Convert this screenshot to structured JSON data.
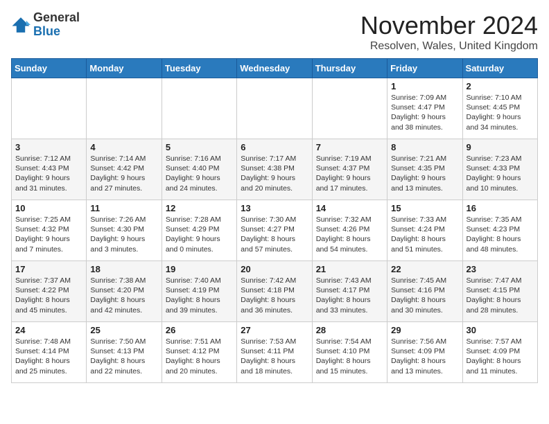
{
  "logo": {
    "general": "General",
    "blue": "Blue"
  },
  "title": "November 2024",
  "location": "Resolven, Wales, United Kingdom",
  "days_of_week": [
    "Sunday",
    "Monday",
    "Tuesday",
    "Wednesday",
    "Thursday",
    "Friday",
    "Saturday"
  ],
  "weeks": [
    [
      {
        "day": "",
        "info": ""
      },
      {
        "day": "",
        "info": ""
      },
      {
        "day": "",
        "info": ""
      },
      {
        "day": "",
        "info": ""
      },
      {
        "day": "",
        "info": ""
      },
      {
        "day": "1",
        "info": "Sunrise: 7:09 AM\nSunset: 4:47 PM\nDaylight: 9 hours and 38 minutes."
      },
      {
        "day": "2",
        "info": "Sunrise: 7:10 AM\nSunset: 4:45 PM\nDaylight: 9 hours and 34 minutes."
      }
    ],
    [
      {
        "day": "3",
        "info": "Sunrise: 7:12 AM\nSunset: 4:43 PM\nDaylight: 9 hours and 31 minutes."
      },
      {
        "day": "4",
        "info": "Sunrise: 7:14 AM\nSunset: 4:42 PM\nDaylight: 9 hours and 27 minutes."
      },
      {
        "day": "5",
        "info": "Sunrise: 7:16 AM\nSunset: 4:40 PM\nDaylight: 9 hours and 24 minutes."
      },
      {
        "day": "6",
        "info": "Sunrise: 7:17 AM\nSunset: 4:38 PM\nDaylight: 9 hours and 20 minutes."
      },
      {
        "day": "7",
        "info": "Sunrise: 7:19 AM\nSunset: 4:37 PM\nDaylight: 9 hours and 17 minutes."
      },
      {
        "day": "8",
        "info": "Sunrise: 7:21 AM\nSunset: 4:35 PM\nDaylight: 9 hours and 13 minutes."
      },
      {
        "day": "9",
        "info": "Sunrise: 7:23 AM\nSunset: 4:33 PM\nDaylight: 9 hours and 10 minutes."
      }
    ],
    [
      {
        "day": "10",
        "info": "Sunrise: 7:25 AM\nSunset: 4:32 PM\nDaylight: 9 hours and 7 minutes."
      },
      {
        "day": "11",
        "info": "Sunrise: 7:26 AM\nSunset: 4:30 PM\nDaylight: 9 hours and 3 minutes."
      },
      {
        "day": "12",
        "info": "Sunrise: 7:28 AM\nSunset: 4:29 PM\nDaylight: 9 hours and 0 minutes."
      },
      {
        "day": "13",
        "info": "Sunrise: 7:30 AM\nSunset: 4:27 PM\nDaylight: 8 hours and 57 minutes."
      },
      {
        "day": "14",
        "info": "Sunrise: 7:32 AM\nSunset: 4:26 PM\nDaylight: 8 hours and 54 minutes."
      },
      {
        "day": "15",
        "info": "Sunrise: 7:33 AM\nSunset: 4:24 PM\nDaylight: 8 hours and 51 minutes."
      },
      {
        "day": "16",
        "info": "Sunrise: 7:35 AM\nSunset: 4:23 PM\nDaylight: 8 hours and 48 minutes."
      }
    ],
    [
      {
        "day": "17",
        "info": "Sunrise: 7:37 AM\nSunset: 4:22 PM\nDaylight: 8 hours and 45 minutes."
      },
      {
        "day": "18",
        "info": "Sunrise: 7:38 AM\nSunset: 4:20 PM\nDaylight: 8 hours and 42 minutes."
      },
      {
        "day": "19",
        "info": "Sunrise: 7:40 AM\nSunset: 4:19 PM\nDaylight: 8 hours and 39 minutes."
      },
      {
        "day": "20",
        "info": "Sunrise: 7:42 AM\nSunset: 4:18 PM\nDaylight: 8 hours and 36 minutes."
      },
      {
        "day": "21",
        "info": "Sunrise: 7:43 AM\nSunset: 4:17 PM\nDaylight: 8 hours and 33 minutes."
      },
      {
        "day": "22",
        "info": "Sunrise: 7:45 AM\nSunset: 4:16 PM\nDaylight: 8 hours and 30 minutes."
      },
      {
        "day": "23",
        "info": "Sunrise: 7:47 AM\nSunset: 4:15 PM\nDaylight: 8 hours and 28 minutes."
      }
    ],
    [
      {
        "day": "24",
        "info": "Sunrise: 7:48 AM\nSunset: 4:14 PM\nDaylight: 8 hours and 25 minutes."
      },
      {
        "day": "25",
        "info": "Sunrise: 7:50 AM\nSunset: 4:13 PM\nDaylight: 8 hours and 22 minutes."
      },
      {
        "day": "26",
        "info": "Sunrise: 7:51 AM\nSunset: 4:12 PM\nDaylight: 8 hours and 20 minutes."
      },
      {
        "day": "27",
        "info": "Sunrise: 7:53 AM\nSunset: 4:11 PM\nDaylight: 8 hours and 18 minutes."
      },
      {
        "day": "28",
        "info": "Sunrise: 7:54 AM\nSunset: 4:10 PM\nDaylight: 8 hours and 15 minutes."
      },
      {
        "day": "29",
        "info": "Sunrise: 7:56 AM\nSunset: 4:09 PM\nDaylight: 8 hours and 13 minutes."
      },
      {
        "day": "30",
        "info": "Sunrise: 7:57 AM\nSunset: 4:09 PM\nDaylight: 8 hours and 11 minutes."
      }
    ]
  ]
}
